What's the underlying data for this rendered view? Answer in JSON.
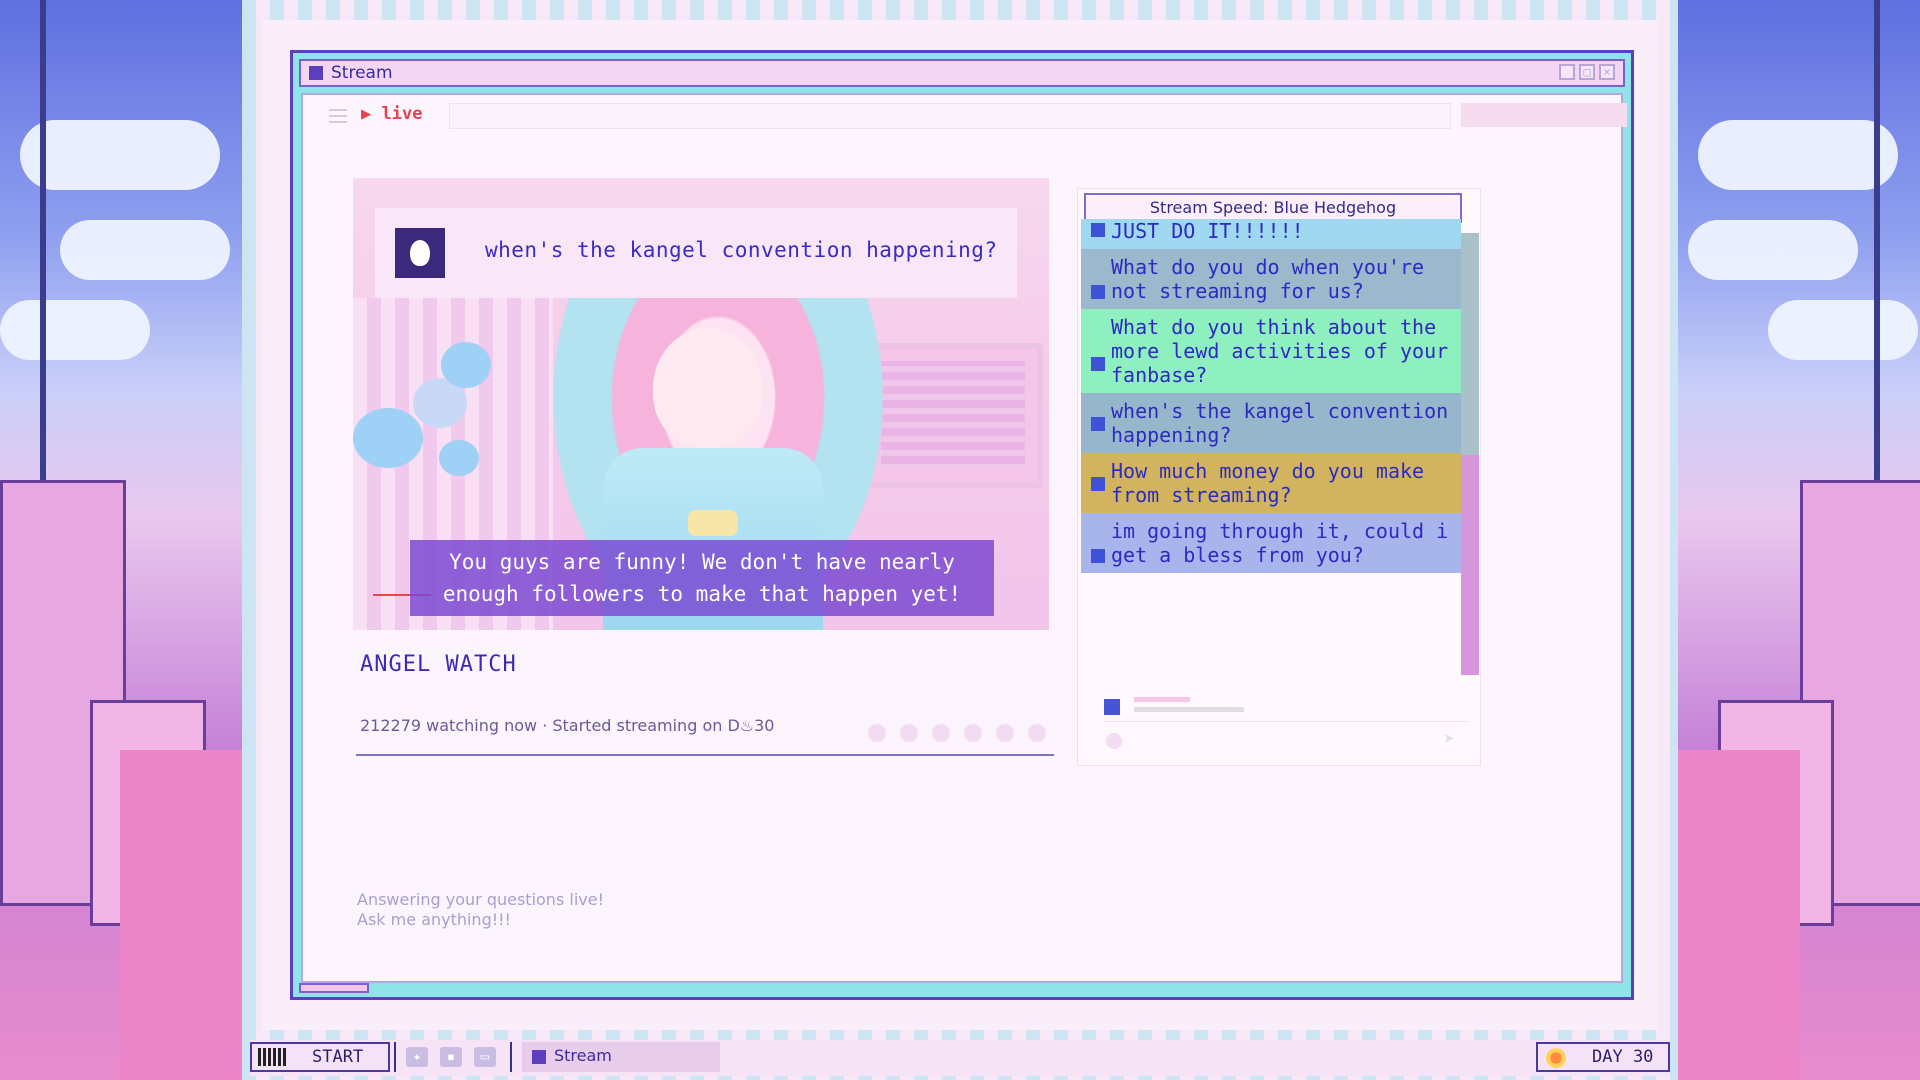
{
  "window": {
    "title": "Stream",
    "live_label": "live"
  },
  "video": {
    "question": "when's the kangel convention happening?",
    "subtitle_line1": "You guys are funny! We don't have nearly",
    "subtitle_line2": "enough followers to make that happen yet!"
  },
  "stream": {
    "title": "ANGEL WATCH",
    "meta": "212279 watching now  ·  Started streaming on D♨30",
    "description_line1": "Answering your questions live!",
    "description_line2": "Ask me anything!!!"
  },
  "chat": {
    "speed_label": "Stream Speed: Blue Hedgehog",
    "messages": [
      {
        "text": "JUST DO IT!!!!!!",
        "color": "#9fd8f0"
      },
      {
        "text": "What do you do when you're not streaming for us?",
        "color": "#9bb8cc"
      },
      {
        "text": "What do you think about the more lewd activities of your fanbase?",
        "color": "#8ff0bf"
      },
      {
        "text": "when's the kangel convention happening?",
        "color": "#96b6cc"
      },
      {
        "text": "How much money do you make from streaming?",
        "color": "#d2b45e"
      },
      {
        "text": "im going through it, could i get a bless from you?",
        "color": "#a8b4ec"
      }
    ],
    "send_icon": "send-icon"
  },
  "taskbar": {
    "start_label": "START",
    "task_label": "Stream",
    "day_label": "DAY 30"
  },
  "colors": {
    "accent": "#5b3fbe",
    "live_red": "#e2434f",
    "window_border": "#8fe4e8"
  }
}
